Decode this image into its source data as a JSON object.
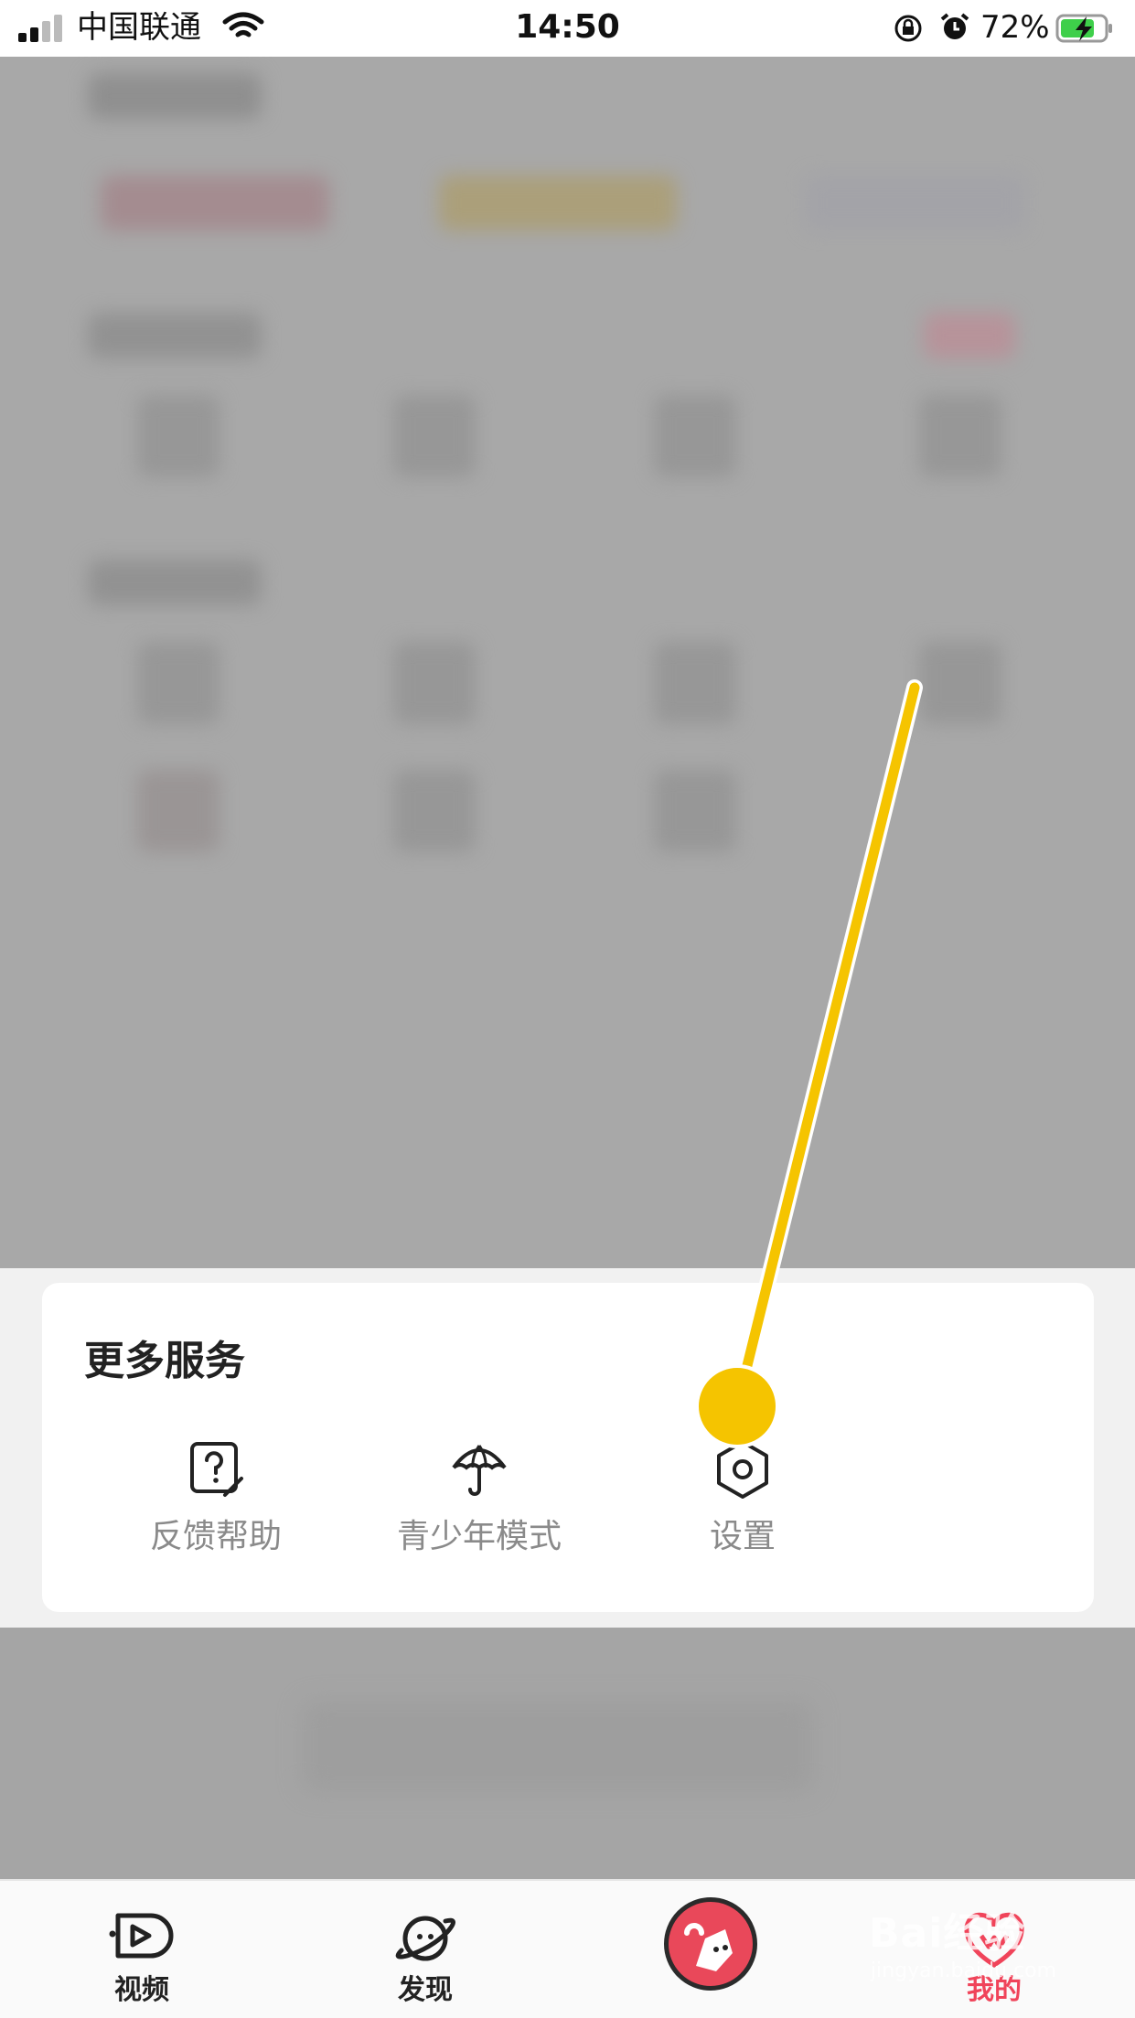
{
  "status_bar": {
    "carrier": "中国联通",
    "time": "14:50",
    "battery_percent": "72%",
    "icons": [
      "signal-icon",
      "wifi-icon",
      "rotation-lock-icon",
      "alarm-icon",
      "battery-charging-icon"
    ]
  },
  "more_services": {
    "title": "更多服务",
    "items": [
      {
        "label": "反馈帮助",
        "icon": "help-feedback-icon"
      },
      {
        "label": "青少年模式",
        "icon": "umbrella-icon"
      },
      {
        "label": "设置",
        "icon": "settings-hexagon-icon"
      }
    ]
  },
  "annotation": {
    "color": "#f5c400"
  },
  "tab_bar": {
    "tabs": [
      {
        "label": "视频",
        "icon": "video-play-icon",
        "active": false
      },
      {
        "label": "发现",
        "icon": "planet-icon",
        "active": false
      },
      {
        "label": "",
        "icon": "center-mascot-button",
        "active": false
      },
      {
        "label": "我的",
        "icon": "profile-icon",
        "active": true
      }
    ],
    "active_color": "#f0445a"
  },
  "watermark": {
    "main": "Bai经验",
    "sub": "jingyan.baidu.com"
  }
}
